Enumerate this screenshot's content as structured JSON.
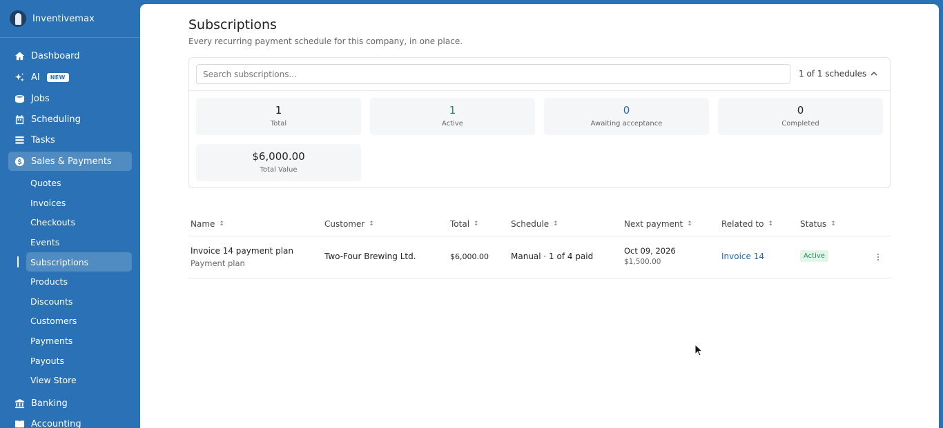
{
  "brand": {
    "name": "Inventivemax"
  },
  "nav": {
    "items": [
      {
        "label": "Dashboard",
        "icon": "home-icon"
      },
      {
        "label": "AI",
        "icon": "sparkle-icon",
        "badge": "NEW"
      },
      {
        "label": "Jobs",
        "icon": "jobs-icon"
      },
      {
        "label": "Scheduling",
        "icon": "calendar-icon"
      },
      {
        "label": "Tasks",
        "icon": "tasks-icon"
      },
      {
        "label": "Sales & Payments",
        "icon": "dollar-icon"
      },
      {
        "label": "Banking",
        "icon": "bank-icon"
      },
      {
        "label": "Accounting",
        "icon": "book-icon"
      }
    ],
    "sub_items": [
      "Quotes",
      "Invoices",
      "Checkouts",
      "Events",
      "Subscriptions",
      "Products",
      "Discounts",
      "Customers",
      "Payments",
      "Payouts",
      "View Store"
    ]
  },
  "page": {
    "title": "Subscriptions",
    "subtitle": "Every recurring payment schedule for this company, in one place."
  },
  "search": {
    "placeholder": "Search subscriptions..."
  },
  "schedule_count": "1 of 1 schedules",
  "stats": [
    {
      "value": "1",
      "label": "Total"
    },
    {
      "value": "1",
      "label": "Active"
    },
    {
      "value": "0",
      "label": "Awaiting acceptance"
    },
    {
      "value": "0",
      "label": "Completed"
    },
    {
      "value": "$6,000.00",
      "label": "Total Value"
    }
  ],
  "table": {
    "headers": [
      "Name",
      "Customer",
      "Total",
      "Schedule",
      "Next payment",
      "Related to",
      "Status"
    ],
    "rows": [
      {
        "name": "Invoice 14 payment plan",
        "type": "Payment plan",
        "customer": "Two-Four Brewing Ltd.",
        "total": "$6,000.00",
        "schedule": "Manual · 1 of 4 paid",
        "next_date": "Oct 09, 2026",
        "next_amount": "$1,500.00",
        "related": "Invoice 14",
        "status": "Active"
      }
    ]
  },
  "colors": {
    "sidebar": "#2a72b5",
    "accent": "#2a66a8",
    "success": "#2a8a5a"
  }
}
